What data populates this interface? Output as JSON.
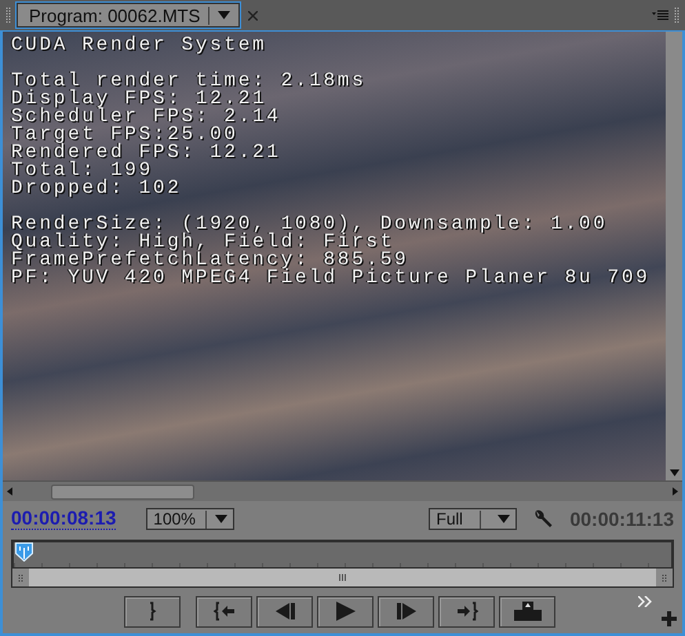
{
  "tab": {
    "title": "Program: 00062.MTS",
    "selected": true
  },
  "overlay": {
    "heading": "CUDA Render System",
    "groups": [
      [
        "Total render time: 2.18ms",
        "Display FPS: 12.21",
        "Scheduler FPS: 2.14",
        "Target FPS:25.00",
        "Rendered FPS: 12.21",
        "Total: 199",
        "Dropped: 102"
      ],
      [
        "RenderSize: (1920, 1080), Downsample: 1.00",
        "Quality: High,  Field: First",
        "FramePrefetchLatency: 885.59",
        "PF: YUV 420 MPEG4 Field Picture Planer 8u 709"
      ]
    ]
  },
  "current_time": "00:00:08:13",
  "zoom": "100%",
  "quality": "Full",
  "duration": "00:00:11:13",
  "playhead": {
    "level": 0
  },
  "transport": [
    {
      "kind": "mark-out"
    },
    {
      "kind": "go-to-in"
    },
    {
      "kind": "step-back"
    },
    {
      "kind": "play"
    },
    {
      "kind": "step-forward"
    },
    {
      "kind": "go-to-out"
    },
    {
      "kind": "export-frame"
    }
  ]
}
